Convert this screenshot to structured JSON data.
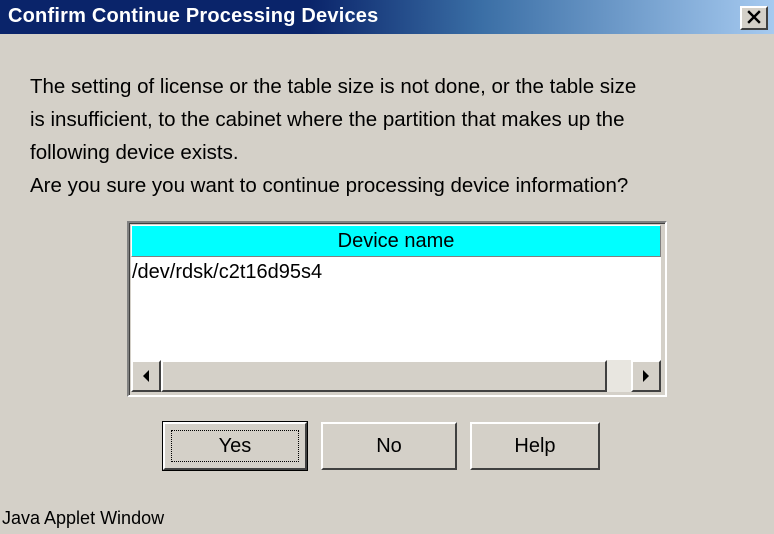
{
  "window": {
    "title": "Confirm Continue Processing Devices",
    "close_glyph": "✕"
  },
  "message": {
    "lines": [
      "The setting of license or the table size is not done, or the table size",
      "is insufficient, to the cabinet where the partition that makes up the",
      "following device exists.",
      "Are you sure you want to continue processing device information?"
    ]
  },
  "table": {
    "header": "Device name",
    "header_color": "#00ffff",
    "rows": [
      "/dev/rdsk/c2t16d95s4"
    ]
  },
  "buttons": {
    "yes": "Yes",
    "no": "No",
    "help": "Help"
  },
  "status": "Java Applet Window"
}
